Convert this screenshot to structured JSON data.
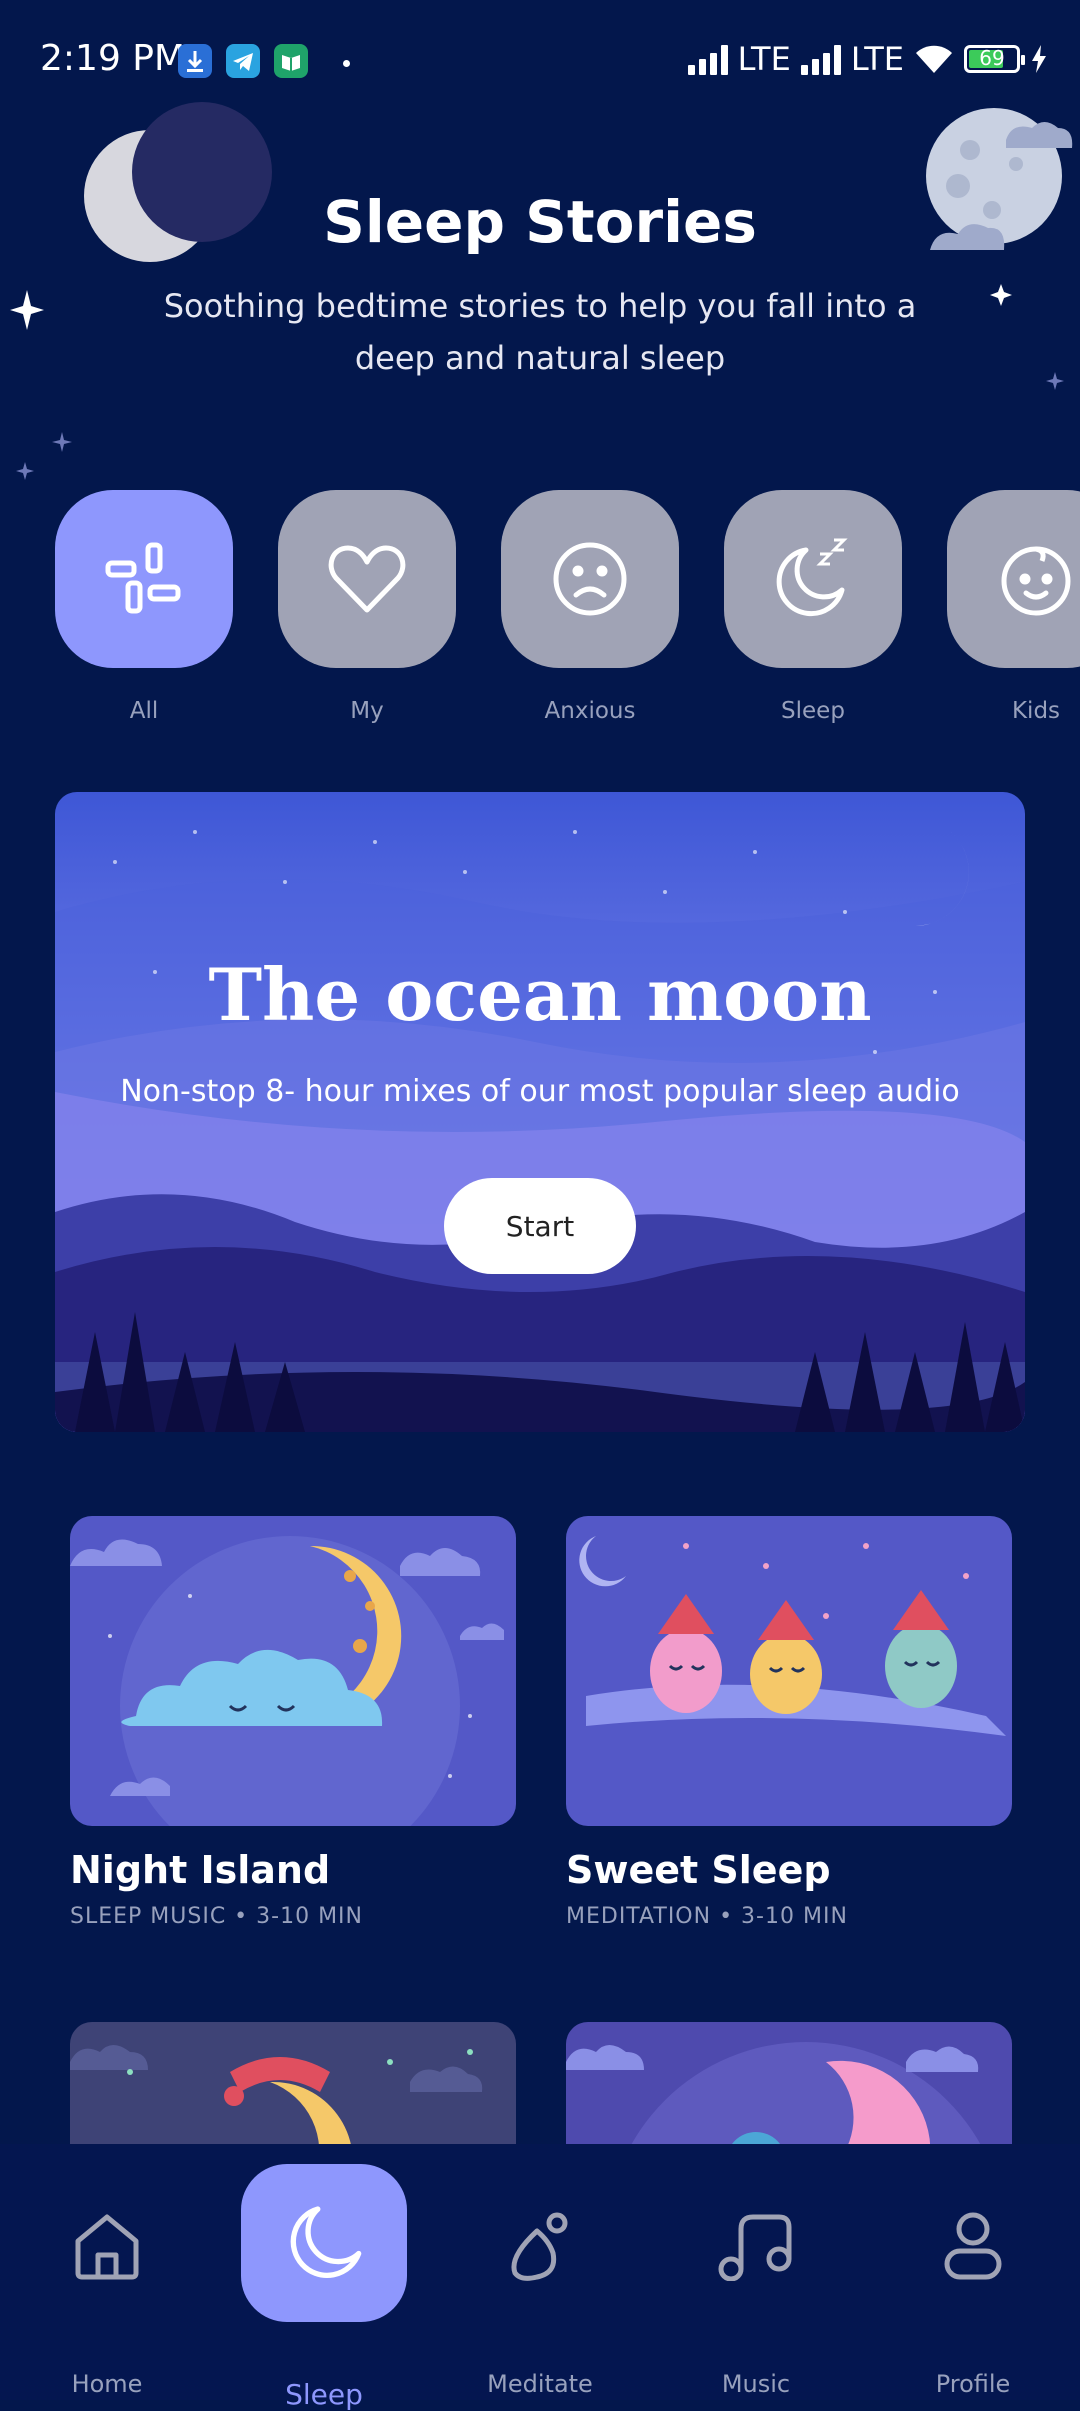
{
  "status_bar": {
    "time": "2:19 PM",
    "network1": "LTE",
    "network2": "LTE",
    "battery": "69",
    "app_icons": [
      "download-icon",
      "telegram-icon",
      "book-app-icon"
    ]
  },
  "header": {
    "title": "Sleep Stories",
    "subtitle": "Soothing bedtime stories to help you fall into a deep and natural sleep"
  },
  "categories": [
    {
      "label": "All",
      "icon": "grid-icon",
      "active": true
    },
    {
      "label": "My",
      "icon": "heart-icon",
      "active": false
    },
    {
      "label": "Anxious",
      "icon": "sad-face-icon",
      "active": false
    },
    {
      "label": "Sleep",
      "icon": "moon-zzz-icon",
      "active": false
    },
    {
      "label": "Kids",
      "icon": "baby-face-icon",
      "active": false
    }
  ],
  "featured": {
    "title": "The ocean moon",
    "subtitle": "Non-stop 8- hour mixes of our most popular sleep audio",
    "button": "Start"
  },
  "cards": [
    {
      "title": "Night Island",
      "subtitle": "SLEEP MUSIC • 3-10 MIN"
    },
    {
      "title": "Sweet Sleep",
      "subtitle": "MEDITATION • 3-10 MIN"
    }
  ],
  "nav": [
    {
      "label": "Home",
      "icon": "home-icon"
    },
    {
      "label": "Sleep",
      "icon": "moon-icon",
      "active": true
    },
    {
      "label": "Meditate",
      "icon": "meditate-icon"
    },
    {
      "label": "Music",
      "icon": "music-icon"
    },
    {
      "label": "Profile",
      "icon": "profile-icon"
    }
  ],
  "colors": {
    "background": "#03174C",
    "accent": "#8E97FD",
    "category_inactive": "#A0A3B5",
    "muted_text": "#98A1BD"
  }
}
